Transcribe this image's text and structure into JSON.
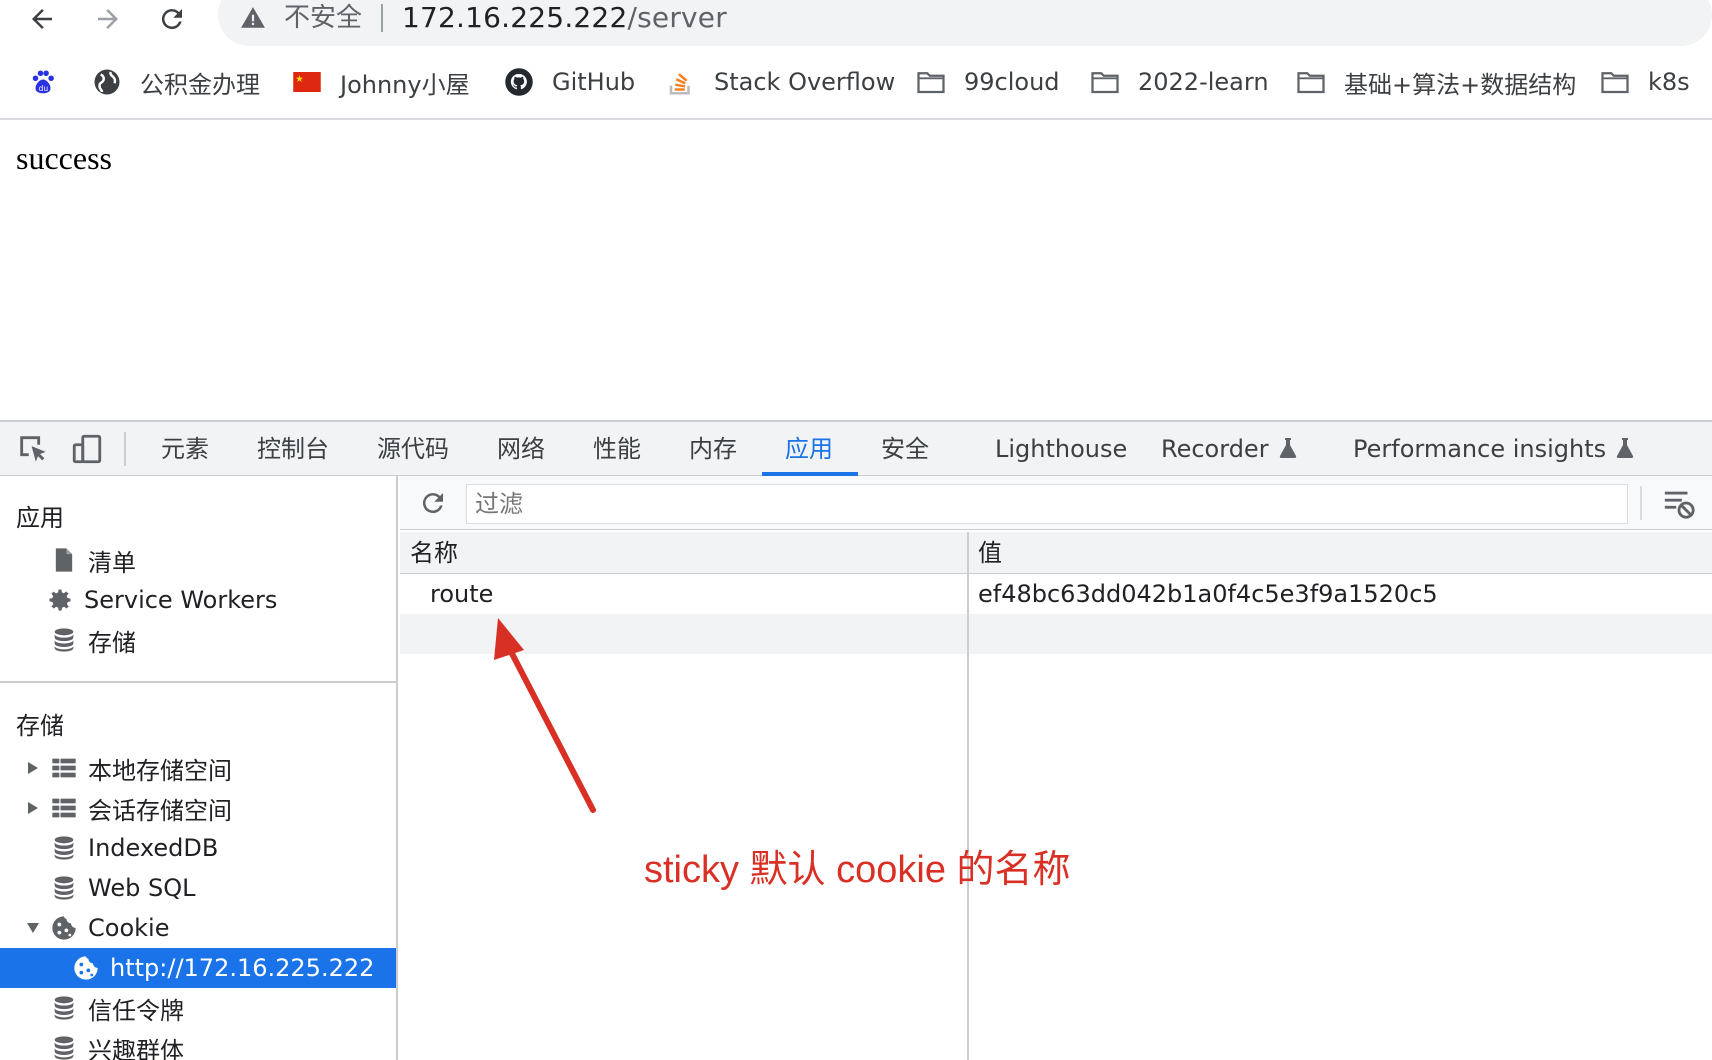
{
  "browser": {
    "security_label": "不安全",
    "url_host": "172.16.225.222",
    "url_path": "/server",
    "bookmarks": [
      {
        "label": "",
        "icon": "baidu-paw-icon"
      },
      {
        "label": "公积金办理",
        "icon": "globe-icon"
      },
      {
        "label": "Johnny小屋",
        "icon": "china-flag-icon"
      },
      {
        "label": "GitHub",
        "icon": "github-icon"
      },
      {
        "label": "Stack Overflow",
        "icon": "stackoverflow-icon"
      },
      {
        "label": "99cloud",
        "icon": "folder-icon"
      },
      {
        "label": "2022-learn",
        "icon": "folder-icon"
      },
      {
        "label": "基础+算法+数据结构",
        "icon": "folder-icon"
      },
      {
        "label": "k8s",
        "icon": "folder-icon"
      }
    ]
  },
  "page": {
    "body_text": "success"
  },
  "devtools": {
    "tabs": [
      "元素",
      "控制台",
      "源代码",
      "网络",
      "性能",
      "内存",
      "应用",
      "安全",
      "Lighthouse",
      "Recorder",
      "Performance insights"
    ],
    "active_tab": "应用",
    "sidebar": {
      "app_heading": "应用",
      "app_items": [
        "清单",
        "Service Workers",
        "存储"
      ],
      "storage_heading": "存储",
      "storage_items": [
        "本地存储空间",
        "会话存储空间",
        "IndexedDB",
        "Web SQL",
        "Cookie",
        "http://172.16.225.222",
        "信任令牌",
        "兴趣群体"
      ],
      "selected_item": "http://172.16.225.222"
    },
    "filter": {
      "placeholder": "过滤"
    },
    "cookies_table": {
      "columns": [
        "名称",
        "值"
      ],
      "rows": [
        {
          "name": "route",
          "value": "ef48bc63dd042b1a0f4c5e3f9a1520c5"
        }
      ]
    }
  },
  "annotation": {
    "text": "sticky 默认 cookie 的名称",
    "color": "#d93025"
  },
  "colors": {
    "accent": "#1a73e8",
    "annotation": "#d93025"
  }
}
